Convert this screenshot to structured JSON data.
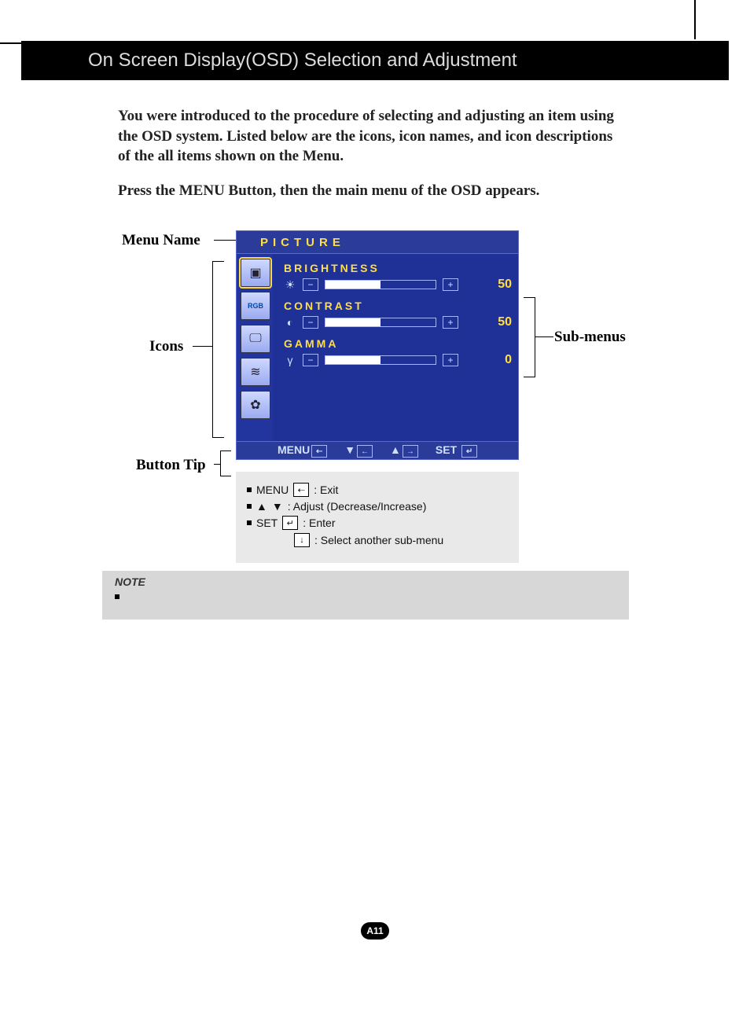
{
  "header": {
    "title": "On Screen Display(OSD) Selection and Adjustment"
  },
  "intro": {
    "p1": "You were introduced to the procedure of selecting and adjusting an item using the OSD system.  Listed below are the icons, icon names, and icon descriptions of the all items shown on the Menu.",
    "p2": "Press the MENU Button, then the main menu of the OSD appears."
  },
  "labels": {
    "menu_name": "Menu Name",
    "icons": "Icons",
    "sub_menus": "Sub-menus",
    "button_tip": "Button Tip"
  },
  "osd": {
    "title": "PICTURE",
    "icons": [
      {
        "name": "picture-icon",
        "glyph": "▣",
        "selected": true
      },
      {
        "name": "color-icon",
        "glyph": "RGB",
        "selected": false
      },
      {
        "name": "tracking-icon",
        "glyph": "🖵",
        "selected": false
      },
      {
        "name": "setup-icon",
        "glyph": "≋",
        "selected": false
      },
      {
        "name": "other-icon",
        "glyph": "✿",
        "selected": false
      }
    ],
    "rows": [
      {
        "label": "BRIGHTNESS",
        "icon": "☀",
        "value": 50,
        "percent": 50
      },
      {
        "label": "CONTRAST",
        "icon": "◐",
        "value": 50,
        "percent": 50
      },
      {
        "label": "GAMMA",
        "icon": "γ",
        "value": 0,
        "percent": 50
      }
    ],
    "footer": {
      "menu": "MENU",
      "set": "SET"
    }
  },
  "legend": {
    "line1_prefix": "MENU",
    "line1_suffix": ": Exit",
    "line2_suffix": ": Adjust (Decrease/Increase)",
    "line3_prefix": "SET",
    "line3_suffix": ": Enter",
    "line4_suffix": ": Select another sub-menu"
  },
  "note": {
    "title": "NOTE"
  },
  "page_number": "A11"
}
